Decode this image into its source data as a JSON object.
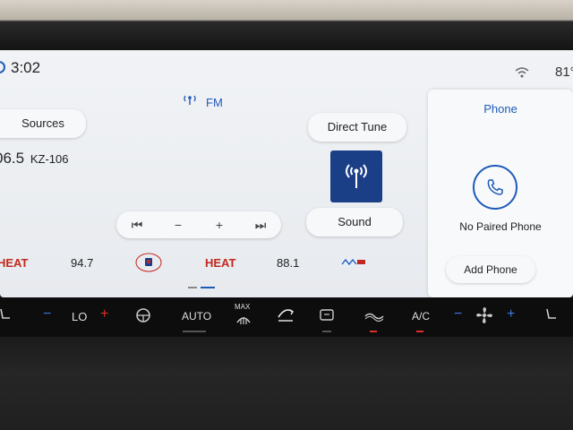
{
  "status": {
    "time": "3:02",
    "temperature": "81°"
  },
  "radio": {
    "band_label": "FM",
    "sources_label": "Sources",
    "direct_tune_label": "Direct Tune",
    "sound_label": "Sound",
    "frequency": "06.5",
    "call_sign": "KZ-106",
    "transport": {
      "prev": "⏮",
      "minus": "−",
      "plus": "+",
      "next": "⏭"
    },
    "presets": [
      {
        "label": "HEAT"
      },
      {
        "label": "94.7"
      },
      {
        "label": "HEAT"
      },
      {
        "label": "88.1"
      }
    ]
  },
  "phone": {
    "title": "Phone",
    "status_text": "No Paired Phone",
    "add_phone_label": "Add Phone"
  },
  "hvac": {
    "left_minus": "−",
    "left_temp": "LO",
    "left_plus": "+",
    "auto_label": "AUTO",
    "max_label": "MAX",
    "ac_label": "A/C",
    "fan_minus": "−",
    "fan_plus": "+"
  },
  "colors": {
    "accent": "#1e5bb8",
    "tile": "#1b3f86",
    "heat": "#c2281f"
  }
}
